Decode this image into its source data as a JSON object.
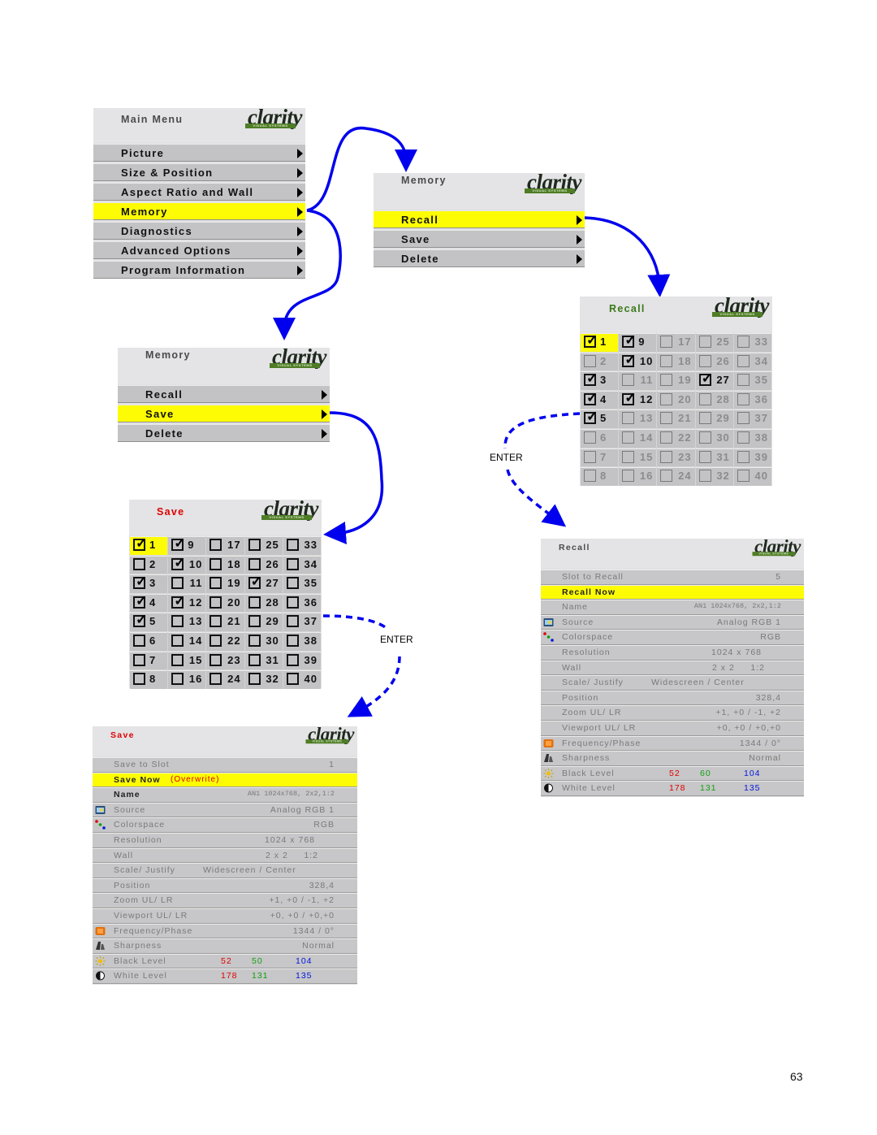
{
  "logo": {
    "word": "clarity",
    "tagline": "VISUAL SYSTEMS"
  },
  "main_menu": {
    "title": "Main Menu",
    "items": [
      {
        "label": "Picture",
        "selected": false
      },
      {
        "label": "Size & Position",
        "selected": false
      },
      {
        "label": "Aspect Ratio and Wall",
        "selected": false
      },
      {
        "label": "Memory",
        "selected": true
      },
      {
        "label": "Diagnostics",
        "selected": false
      },
      {
        "label": "Advanced Options",
        "selected": false
      },
      {
        "label": "Program Information",
        "selected": false
      }
    ]
  },
  "memory_menu_recall": {
    "title": "Memory",
    "items": [
      {
        "label": "Recall",
        "selected": true
      },
      {
        "label": "Save",
        "selected": false
      },
      {
        "label": "Delete",
        "selected": false
      }
    ]
  },
  "memory_menu_save": {
    "title": "Memory",
    "items": [
      {
        "label": "Recall",
        "selected": false
      },
      {
        "label": "Save",
        "selected": true
      },
      {
        "label": "Delete",
        "selected": false
      }
    ]
  },
  "recall_grid": {
    "title": "Recall",
    "title_color": "#3a7a1a",
    "selected_slot": 1,
    "checked_slots": [
      1,
      3,
      4,
      5,
      9,
      10,
      12,
      27
    ],
    "slot_count": 40
  },
  "save_grid": {
    "title": "Save",
    "title_color": "#e00000",
    "selected_slot": 1,
    "checked_slots": [
      1,
      3,
      4,
      5,
      9,
      10,
      12,
      27
    ],
    "slot_count": 40
  },
  "enter_label": "ENTER",
  "recall_detail": {
    "title": "Recall",
    "slot_label": "Slot to Recall",
    "slot_value": "5",
    "action": "Recall Now",
    "action_suffix": "",
    "name_label": "Name",
    "name_value": "AN1 1024x768, 2x2,1:2",
    "source_label": "Source",
    "source_value": "Analog RGB 1",
    "colorspace_label": "Colorspace",
    "colorspace_value": "RGB",
    "resolution_label": "Resolution",
    "resolution_value": "1024 x 768",
    "wall_label": "Wall",
    "wall_value": "2 x 2     1:2",
    "scale_label": "Scale/ Justify",
    "scale_value": "Widescreen / Center",
    "position_label": "Position",
    "position_value": "328,4",
    "zoom_label": "Zoom UL/ LR",
    "zoom_value": "+1, +0  /  -1, +2",
    "viewport_label": "Viewport  UL/ LR",
    "viewport_value": "+0, +0  / +0,+0",
    "freq_label": "Frequency/Phase",
    "freq_value": "1344 / 0°",
    "sharp_label": "Sharpness",
    "sharp_value": "Normal",
    "black_label": "Black Level",
    "black_r": "52",
    "black_g": "60",
    "black_b": "104",
    "white_label": "White Level",
    "white_r": "178",
    "white_g": "131",
    "white_b": "135"
  },
  "save_detail": {
    "title": "Save",
    "slot_label": "Save to Slot",
    "slot_value": "1",
    "action": "Save Now",
    "action_suffix": "(Overwrite)",
    "name_label": "Name",
    "name_value": "AN1 1024x768, 2x2,1:2",
    "source_label": "Source",
    "source_value": "Analog RGB 1",
    "colorspace_label": "Colorspace",
    "colorspace_value": "RGB",
    "resolution_label": "Resolution",
    "resolution_value": "1024 x 768",
    "wall_label": "Wall",
    "wall_value": "2 x 2     1:2",
    "scale_label": "Scale/ Justify",
    "scale_value": "Widescreen / Center",
    "position_label": "Position",
    "position_value": "328,4",
    "zoom_label": "Zoom UL/ LR",
    "zoom_value": "+1, +0  /  -1, +2",
    "viewport_label": "Viewport  UL/ LR",
    "viewport_value": "+0, +0  / +0,+0",
    "freq_label": "Frequency/Phase",
    "freq_value": "1344 / 0°",
    "sharp_label": "Sharpness",
    "sharp_value": "Normal",
    "black_label": "Black Level",
    "black_r": "52",
    "black_g": "50",
    "black_b": "104",
    "white_label": "White Level",
    "white_r": "178",
    "white_g": "131",
    "white_b": "135"
  },
  "page_number": "63",
  "colors": {
    "highlight": "#fdfc04",
    "arrow": "#0000ee",
    "menu_bg": "#c3c2c4"
  }
}
